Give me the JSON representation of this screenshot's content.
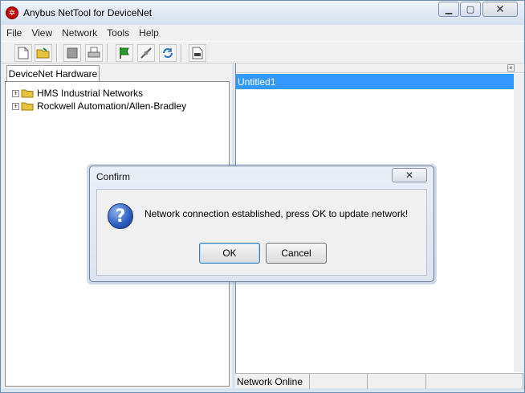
{
  "window": {
    "title": "Anybus NetTool for DeviceNet",
    "minimize_glyph": "▁",
    "maximize_glyph": "▢",
    "close_glyph": "✕"
  },
  "menu": {
    "items": [
      {
        "label": "File"
      },
      {
        "label": "View"
      },
      {
        "label": "Network"
      },
      {
        "label": "Tools"
      },
      {
        "label": "Help"
      }
    ]
  },
  "toolbar": {
    "icons": [
      "new-document-icon",
      "open-folder-icon",
      "stop-icon",
      "print-icon",
      "go-online-icon",
      "connect-icon",
      "refresh-icon",
      "eds-file-icon"
    ]
  },
  "left_pane": {
    "tab_label": "DeviceNet Hardware",
    "tree": [
      {
        "label": "HMS Industrial Networks",
        "expander": "+"
      },
      {
        "label": "Rockwell Automation/Allen-Bradley",
        "expander": "+"
      }
    ]
  },
  "right_pane": {
    "close_glyph": "×",
    "items": [
      {
        "label": "Untitled1",
        "selected": true
      }
    ]
  },
  "statusbar": {
    "cells": [
      "Network Online",
      "",
      "",
      ""
    ]
  },
  "dialog": {
    "title": "Confirm",
    "close_glyph": "✕",
    "icon": "question-icon",
    "icon_glyph": "?",
    "message": "Network connection established, press OK to update network!",
    "ok_label": "OK",
    "cancel_label": "Cancel"
  },
  "colors": {
    "selection": "#3399ff",
    "folder": "#e8c23a",
    "title_bar": "#d5e1ef"
  }
}
